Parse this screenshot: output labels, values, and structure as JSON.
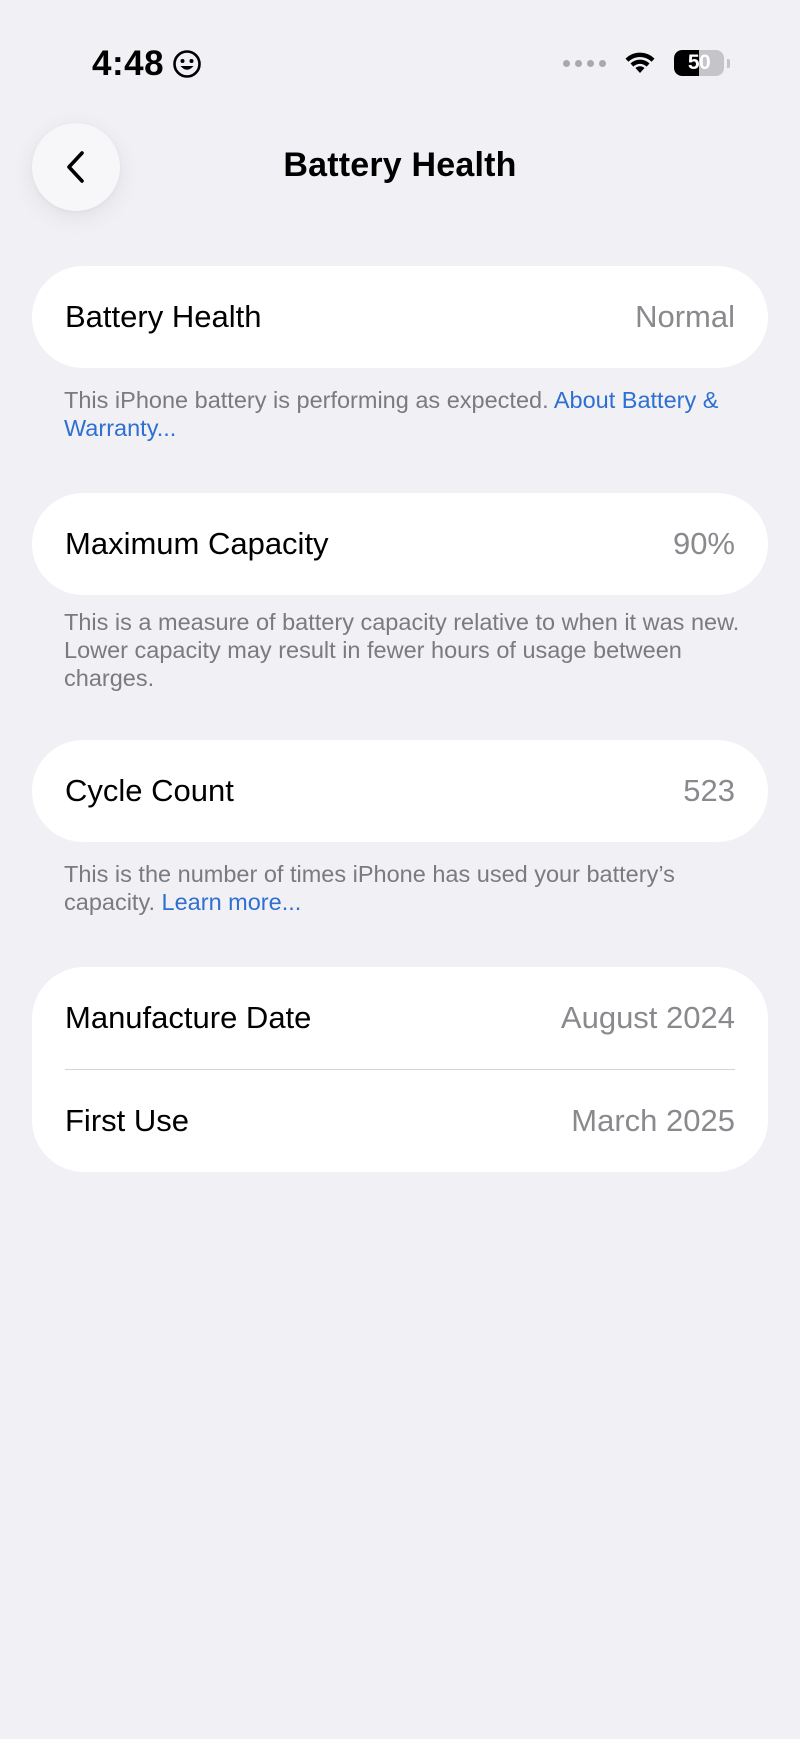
{
  "status_bar": {
    "time": "4:48",
    "time_emoji_icon": "smiley-icon",
    "battery_level": "50",
    "battery_fraction": 0.5
  },
  "nav": {
    "back_icon": "chevron-left-icon",
    "title": "Battery Health"
  },
  "battery_health": {
    "label": "Battery Health",
    "value": "Normal",
    "footnote_text": "This iPhone battery is performing as expected. ",
    "footnote_link": "About Battery & Warranty..."
  },
  "maximum_capacity": {
    "label": "Maximum Capacity",
    "value": "90%",
    "footnote_text": "This is a measure of battery capacity relative to when it was new. Lower capacity may result in fewer hours of usage between charges."
  },
  "cycle_count": {
    "label": "Cycle Count",
    "value": "523",
    "footnote_text": "This is the number of times iPhone has used your battery’s capacity. ",
    "footnote_link": "Learn more..."
  },
  "dates": {
    "manufacture_label": "Manufacture Date",
    "manufacture_value": "August 2024",
    "first_use_label": "First Use",
    "first_use_value": "March 2025"
  },
  "colors": {
    "background": "#f0f0f5",
    "card": "#ffffff",
    "link": "#2f6fd0",
    "secondary_text": "#8a8a8e"
  }
}
